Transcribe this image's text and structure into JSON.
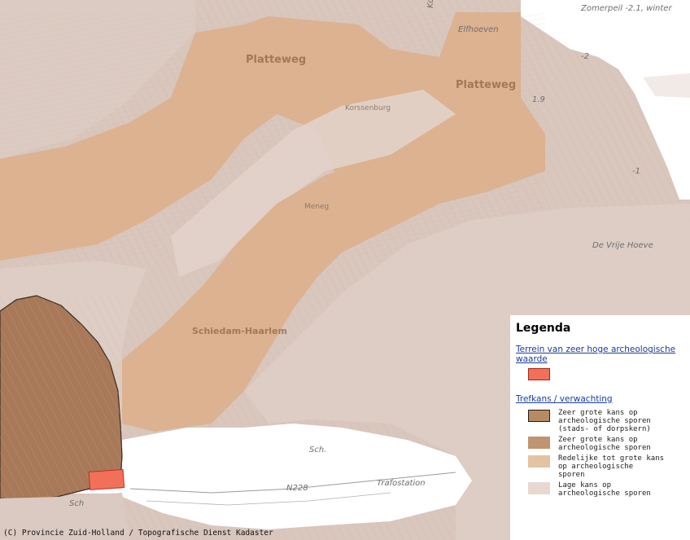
{
  "map": {
    "colors": {
      "background": "#d9c6bd",
      "river_white": "#ffffff",
      "band_orange": "#dcb291",
      "band_light": "#e2d2ca",
      "old_town": "#a87858",
      "old_town_outline": "#3a2a1e",
      "high_value": "#f2705a"
    },
    "labels": {
      "platteweg_1": "Platteweg",
      "platteweg_2": "Platteweg",
      "zomerpeil": "Zomerpeil -2.1, winter",
      "elfhoeven": "Elfhoeven",
      "korssenburg": "Korssenburg",
      "schiedam_haarlem": "Schiedam-Haarlem",
      "menegl": "Meneg",
      "de_vrije_hoeve": "De Vrije Hoeve",
      "trafostation": "Trafostation",
      "sch": "Sch",
      "sch2": "Sch.",
      "n228": "N228",
      "depth_1": "-2",
      "depth_2": "-1",
      "depth_3": "1.9",
      "k": "Kor"
    }
  },
  "legend": {
    "title": "Legenda",
    "section1_title": "Terrein van zeer hoge archeologische waarde",
    "section1_items": [
      {
        "color": "#f2705a",
        "label": ""
      }
    ],
    "section2_title": "Trefkans / verwachting",
    "section2_items": [
      {
        "color": "#b88a62",
        "label": "Zeer grote kans op\narcheologische sporen\n(stads- of dorpskern)"
      },
      {
        "color": "#c09470",
        "label": "Zeer grote kans op\narcheologische sporen"
      },
      {
        "color": "#e3c3a4",
        "label": "Redelijke tot grote kans\nop archeologische\nsporen"
      },
      {
        "color": "#e8d9d0",
        "label": "Lage kans op\narcheologische sporen"
      }
    ]
  },
  "copyright": "(C) Provincie Zuid-Holland / Topografische Dienst Kadaster"
}
